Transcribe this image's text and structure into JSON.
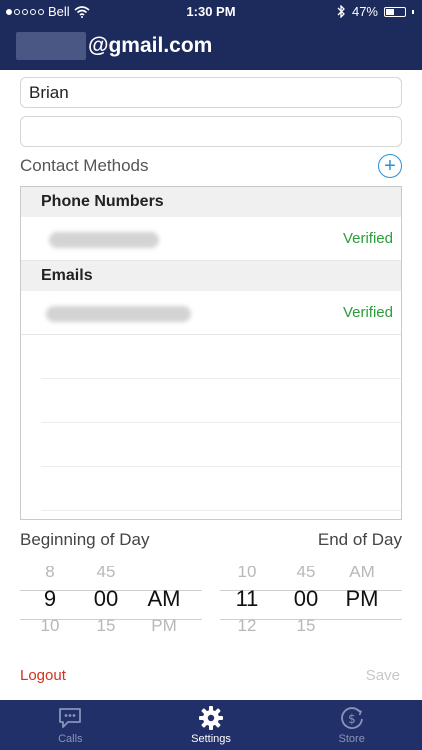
{
  "status_bar": {
    "carrier": "Bell",
    "time": "1:30 PM",
    "battery": "47%",
    "battery_level": 0.47
  },
  "header": {
    "email_suffix": "@gmail.com"
  },
  "form": {
    "first_name_value": "Brian",
    "second_field_value": ""
  },
  "contact_methods": {
    "label": "Contact Methods",
    "groups": [
      {
        "title": "Phone Numbers",
        "status": "Verified"
      },
      {
        "title": "Emails",
        "status": "Verified"
      }
    ]
  },
  "schedule": {
    "begin_label": "Beginning of Day",
    "end_label": "End of Day",
    "begin": {
      "hour_prev": "8",
      "hour": "9",
      "hour_next": "10",
      "minute_prev": "45",
      "minute": "00",
      "minute_next": "15",
      "ampm": "AM",
      "ampm_next": "PM"
    },
    "end": {
      "hour_prev": "10",
      "hour": "11",
      "hour_next": "12",
      "minute_prev": "45",
      "minute": "00",
      "minute_next": "15",
      "ampm_prev": "AM",
      "ampm": "PM"
    }
  },
  "actions": {
    "logout": "Logout",
    "save": "Save"
  },
  "tabs": [
    {
      "label": "Calls",
      "icon": "chat-bubble-icon"
    },
    {
      "label": "Settings",
      "icon": "gear-icon"
    },
    {
      "label": "Store",
      "icon": "dollar-clock-icon"
    }
  ],
  "colors": {
    "header_bg": "#1d2a5c",
    "tab_bar_bg": "#22306a",
    "verified": "#2a9d3a",
    "logout": "#d6301c",
    "accent": "#2a8fd6"
  }
}
